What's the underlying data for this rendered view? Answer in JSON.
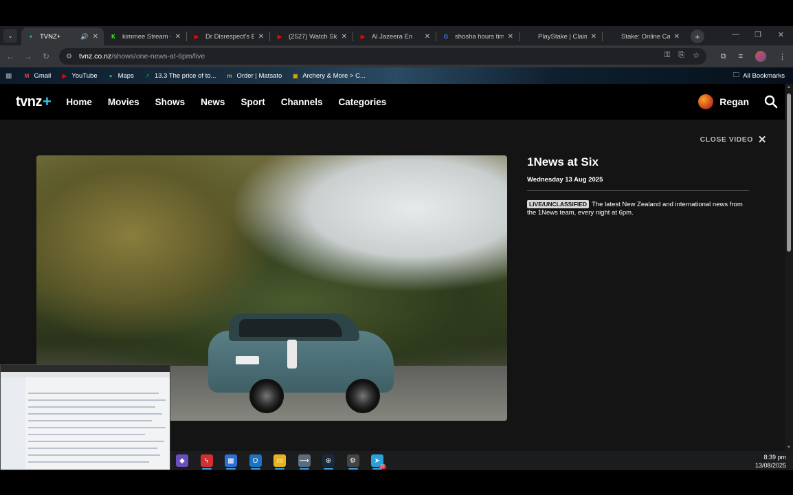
{
  "browser": {
    "tabs": [
      {
        "title": "TVNZ+",
        "active": true,
        "icon": "tvnz-icon",
        "color": "#2ec5e8",
        "glyph": "+"
      },
      {
        "title": "kimmee Stream -",
        "icon": "kick-icon",
        "color": "#53fc18",
        "glyph": "K"
      },
      {
        "title": "Dr Disrespect's B",
        "icon": "youtube-icon",
        "color": "#ff0000",
        "glyph": "▶"
      },
      {
        "title": "(2527) Watch Sk",
        "icon": "youtube-icon",
        "color": "#ff0000",
        "glyph": "▶"
      },
      {
        "title": "Al Jazeera En",
        "icon": "youtube-icon",
        "color": "#ff0000",
        "glyph": "▶"
      },
      {
        "title": "shosha hours tim",
        "icon": "google-icon",
        "color": "#4285f4",
        "glyph": "G"
      },
      {
        "title": "PlayStake | Claim",
        "icon": "stake-icon",
        "color": "#1f2124",
        "glyph": "S"
      },
      {
        "title": "Stake: Online Cas",
        "icon": "stake-icon",
        "color": "#1f2124",
        "glyph": "S"
      }
    ],
    "url_host": "tvnz.co.nz",
    "url_path": "/shows/one-news-at-6pm/live",
    "bookmarks": [
      {
        "label": "Gmail",
        "icon": "gmail-icon",
        "color": "#ea4335",
        "glyph": "M"
      },
      {
        "label": "YouTube",
        "icon": "youtube-icon",
        "color": "#ff0000",
        "glyph": "▶"
      },
      {
        "label": "Maps",
        "icon": "maps-icon",
        "color": "#34a853",
        "glyph": "●"
      },
      {
        "label": "13.3 The price of to...",
        "icon": "chart-icon",
        "color": "#1f7a3a",
        "glyph": "↗"
      },
      {
        "label": "Order | Matsato",
        "icon": "matsato-icon",
        "color": "#f5a623",
        "glyph": "m"
      },
      {
        "label": "Archery & More > C...",
        "icon": "archery-icon",
        "color": "#e0a800",
        "glyph": "▣"
      }
    ],
    "all_bookmarks": "All Bookmarks"
  },
  "site": {
    "logo_text": "tvnz",
    "logo_plus": "+",
    "nav": [
      "Home",
      "Movies",
      "Shows",
      "News",
      "Sport",
      "Channels",
      "Categories"
    ],
    "user_name": "Regan",
    "close_video": "CLOSE VIDEO",
    "show_title": "1News at Six",
    "show_date": "Wednesday 13 Aug 2025",
    "badge": "LIVE/UNCLASSIFIED",
    "description": "The latest New Zealand and international news from the 1News team, every night at 6pm."
  },
  "taskbar": {
    "time": "8:39 pm",
    "date": "13/08/2025",
    "icons": [
      "app-icon",
      "flash-icon",
      "store-icon",
      "outlook-icon",
      "folder-icon",
      "link-icon",
      "steam-icon",
      "settings-icon",
      "telegram-icon"
    ],
    "telegram_badge": "37"
  }
}
